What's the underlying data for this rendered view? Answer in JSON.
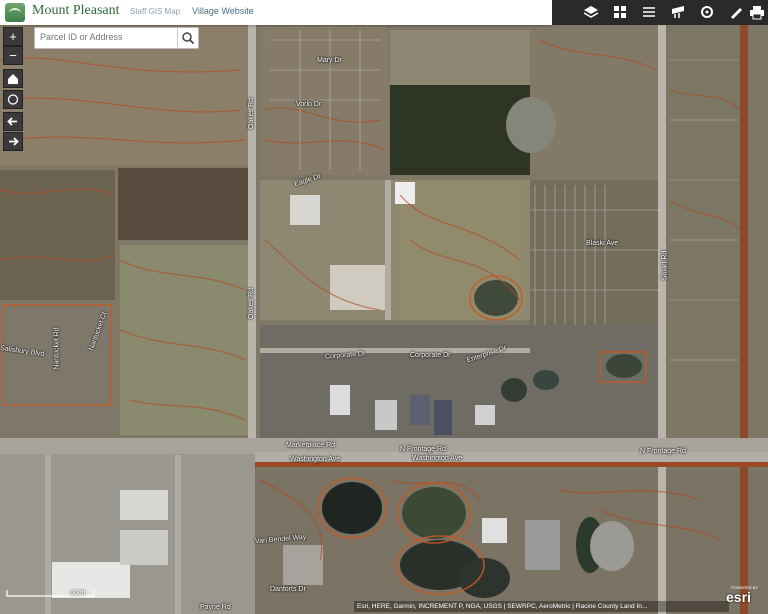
{
  "header": {
    "app_title": "Mount Pleasant",
    "subtitle": "Staff GIS Map",
    "website_link": "Village Website"
  },
  "toolbar": {
    "tools": [
      {
        "icon": "layers-icon"
      },
      {
        "icon": "basemap-gallery-icon"
      },
      {
        "icon": "legend-icon"
      },
      {
        "icon": "measure-icon"
      },
      {
        "icon": "settings-icon"
      },
      {
        "icon": "draw-icon"
      },
      {
        "icon": "print-icon"
      }
    ]
  },
  "search": {
    "placeholder": "Parcel ID or Address"
  },
  "map_controls": {
    "zoom_in": "+",
    "zoom_out": "−"
  },
  "streets": [
    {
      "name": "Mary Dr"
    },
    {
      "name": "Vorlo Dr"
    },
    {
      "name": "Eagle Dr"
    },
    {
      "name": "Corporate Dr"
    },
    {
      "name": "Enterprise Dr"
    },
    {
      "name": "Marketplace Rd"
    },
    {
      "name": "N Frontage Rd"
    },
    {
      "name": "Washington Ave"
    },
    {
      "name": "Blaski Ave"
    },
    {
      "name": "Stuart Rd"
    },
    {
      "name": "Oakes Rd"
    },
    {
      "name": "Salisbury Blvd"
    },
    {
      "name": "Nantucket Ct"
    },
    {
      "name": "Nantucket Rd"
    },
    {
      "name": "Van Bendel Way"
    },
    {
      "name": "Danforts Dr"
    },
    {
      "name": "Payne Rd"
    }
  ],
  "scale": {
    "label": "600ft"
  },
  "attribution": "Esri, HERE, Garmin, INCREMENT P, NGA, USGS | SEWRPC, AeroMetric | Racine County Land In...",
  "esri": {
    "powered_by": "POWERED BY",
    "logo": "esri"
  }
}
